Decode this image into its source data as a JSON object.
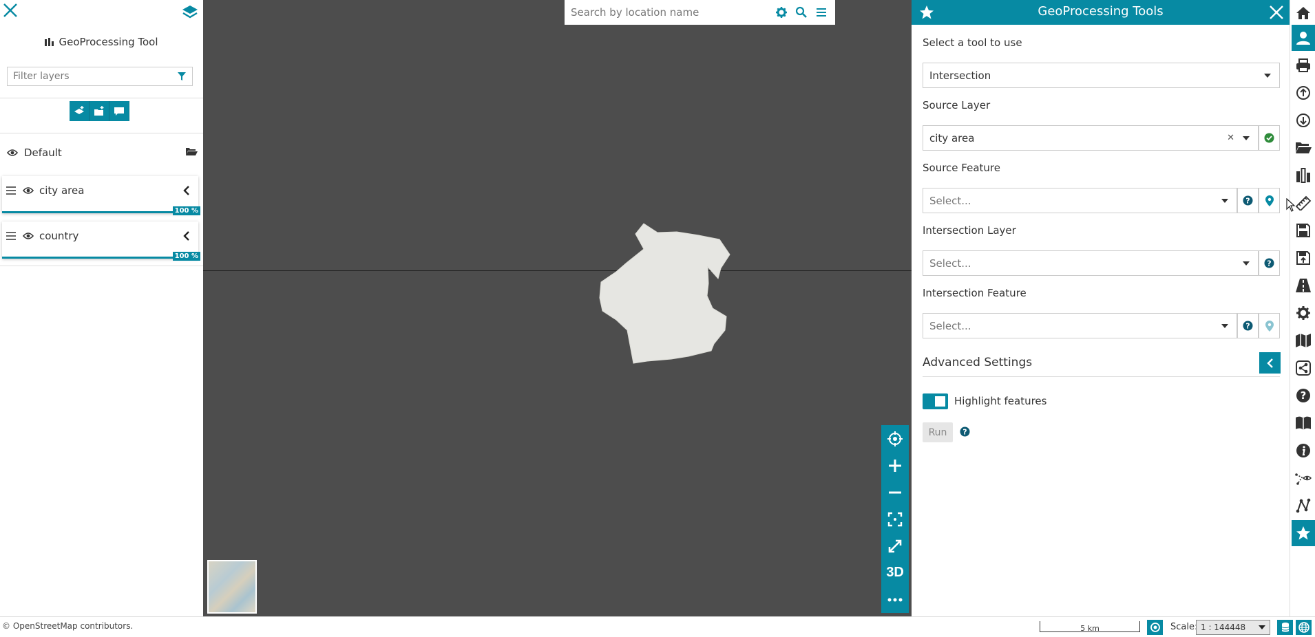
{
  "left_panel": {
    "title": "GeoProcessing Tool",
    "filter_placeholder": "Filter layers",
    "group": {
      "label": "Default"
    },
    "layers": [
      {
        "name": "city area",
        "opacity": "100 %"
      },
      {
        "name": "country",
        "opacity": "100 %"
      }
    ]
  },
  "map": {
    "search_placeholder": "Search by location name",
    "tools": {
      "view3d_label": "3D"
    },
    "attribution": "© OpenStreetMap contributors."
  },
  "right_panel": {
    "title": "GeoProcessing Tools",
    "select_tool_label": "Select a tool to use",
    "tool_value": "Intersection",
    "source_layer_label": "Source Layer",
    "source_layer_value": "city area",
    "source_feature_label": "Source Feature",
    "source_feature_placeholder": "Select...",
    "intersection_layer_label": "Intersection Layer",
    "intersection_layer_placeholder": "Select...",
    "intersection_feature_label": "Intersection Feature",
    "intersection_feature_placeholder": "Select...",
    "advanced_title": "Advanced Settings",
    "highlight_label": "Highlight features",
    "highlight_on": true,
    "run_label": "Run"
  },
  "footer": {
    "scale_bar_label": "5 km",
    "scale_label": "Scale:",
    "scale_value": "1 : 144448"
  },
  "colors": {
    "accent": "#078aa3",
    "map_bg": "#4d4d4d",
    "shape_fill": "#e6e6e2"
  }
}
